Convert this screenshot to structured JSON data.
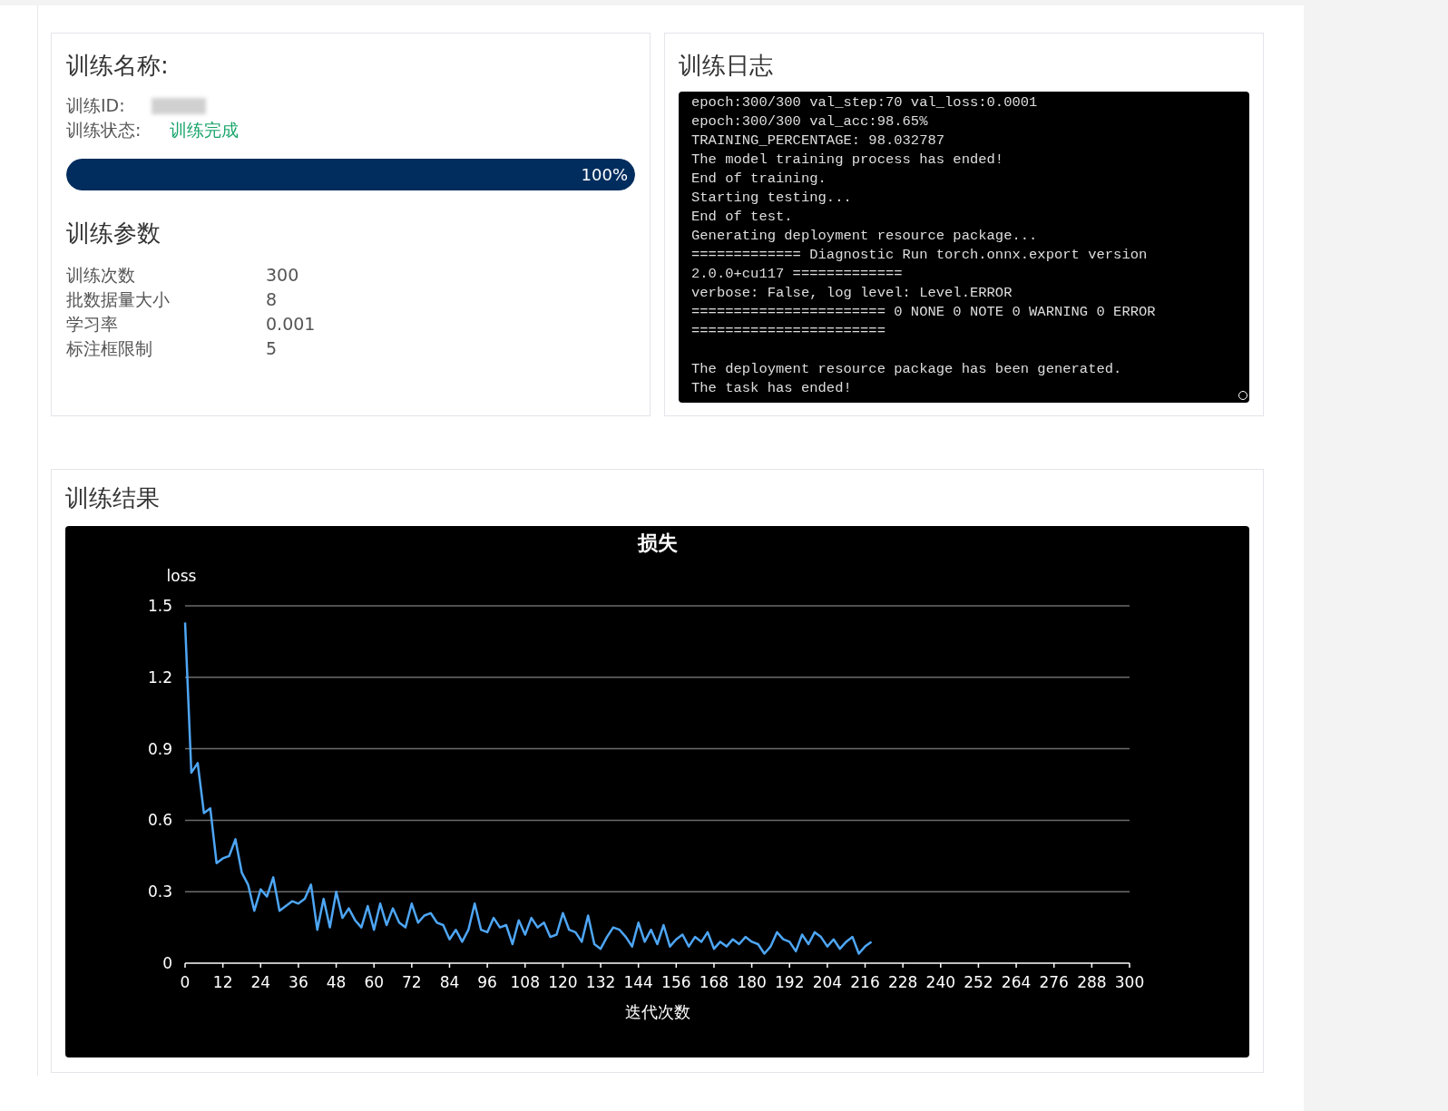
{
  "info_card": {
    "title": "训练名称:",
    "id_label": "训练ID:",
    "status_label": "训练状态:",
    "status_value": "训练完成",
    "progress": {
      "level": 1,
      "reading": "100%"
    }
  },
  "params": {
    "title": "训练参数",
    "rows": [
      {
        "label": "训练次数",
        "value": "300"
      },
      {
        "label": "批数据量大小",
        "value": "8"
      },
      {
        "label": "学习率",
        "value": "0.001"
      },
      {
        "label": "标注框限制",
        "value": "5"
      }
    ]
  },
  "log": {
    "title": "训练日志",
    "blocks": [
      {
        "lines": [
          "epoch:300/300 val_step:70 val_loss:0.0001",
          "epoch:300/300 val_acc:98.65%",
          "TRAINING_PERCENTAGE: 98.032787",
          "The model training process has ended!",
          "End of training.",
          "Starting testing...",
          "End of test.",
          "Generating deployment resource package...",
          "============= Diagnostic Run torch.onnx.export version",
          "2.0.0+cu117 =============",
          "verbose: False, log level: Level.ERROR",
          "======================= 0 NONE 0 NOTE 0 WARNING 0 ERROR",
          "======================="
        ]
      },
      {
        "lines": [
          "The deployment resource package has been generated.",
          "The task has ended!"
        ]
      }
    ]
  },
  "results": {
    "title": "训练结果",
    "chart_data": {
      "type": "line",
      "title": "损失",
      "xlabel": "迭代次数",
      "ylabel": "loss",
      "grid": true,
      "xlim": [
        0,
        300
      ],
      "ylim": [
        0,
        1.5
      ],
      "xticks": [
        0,
        12,
        24,
        36,
        48,
        60,
        72,
        84,
        96,
        108,
        120,
        132,
        144,
        156,
        168,
        180,
        192,
        204,
        216,
        228,
        240,
        252,
        264,
        276,
        288,
        300
      ],
      "yticks": [
        0,
        0.3,
        0.6,
        0.9,
        1.2,
        1.5
      ],
      "x": [
        0,
        2,
        4,
        6,
        8,
        10,
        12,
        14,
        16,
        18,
        20,
        22,
        24,
        26,
        28,
        30,
        32,
        34,
        36,
        38,
        40,
        42,
        44,
        46,
        48,
        50,
        52,
        54,
        56,
        58,
        60,
        62,
        64,
        66,
        68,
        70,
        72,
        74,
        76,
        78,
        80,
        82,
        84,
        86,
        88,
        90,
        92,
        94,
        96,
        98,
        100,
        102,
        104,
        106,
        108,
        110,
        112,
        114,
        116,
        118,
        120,
        122,
        124,
        126,
        128,
        130,
        132,
        134,
        136,
        138,
        140,
        142,
        144,
        146,
        148,
        150,
        152,
        154,
        156,
        158,
        160,
        162,
        164,
        166,
        168,
        170,
        172,
        174,
        176,
        178,
        180,
        182,
        184,
        186,
        188,
        190,
        192,
        194,
        196,
        198,
        200,
        202,
        204,
        206,
        208,
        210,
        212,
        214,
        216,
        218
      ],
      "series": [
        {
          "color": "#4ea6f5",
          "values": [
            1.43,
            0.8,
            0.84,
            0.63,
            0.65,
            0.42,
            0.44,
            0.45,
            0.52,
            0.38,
            0.33,
            0.22,
            0.31,
            0.28,
            0.36,
            0.22,
            0.24,
            0.26,
            0.25,
            0.27,
            0.33,
            0.14,
            0.27,
            0.15,
            0.3,
            0.19,
            0.23,
            0.18,
            0.15,
            0.24,
            0.14,
            0.25,
            0.16,
            0.23,
            0.17,
            0.15,
            0.25,
            0.17,
            0.2,
            0.21,
            0.17,
            0.16,
            0.1,
            0.14,
            0.09,
            0.14,
            0.25,
            0.14,
            0.13,
            0.19,
            0.15,
            0.16,
            0.08,
            0.18,
            0.12,
            0.19,
            0.15,
            0.17,
            0.11,
            0.12,
            0.21,
            0.14,
            0.13,
            0.09,
            0.2,
            0.08,
            0.06,
            0.11,
            0.15,
            0.14,
            0.11,
            0.07,
            0.17,
            0.09,
            0.14,
            0.08,
            0.16,
            0.07,
            0.1,
            0.12,
            0.07,
            0.11,
            0.09,
            0.13,
            0.06,
            0.09,
            0.07,
            0.1,
            0.08,
            0.11,
            0.09,
            0.08,
            0.04,
            0.07,
            0.13,
            0.1,
            0.09,
            0.05,
            0.12,
            0.08,
            0.13,
            0.11,
            0.07,
            0.1,
            0.06,
            0.09,
            0.11,
            0.04,
            0.07,
            0.09
          ]
        }
      ]
    }
  }
}
